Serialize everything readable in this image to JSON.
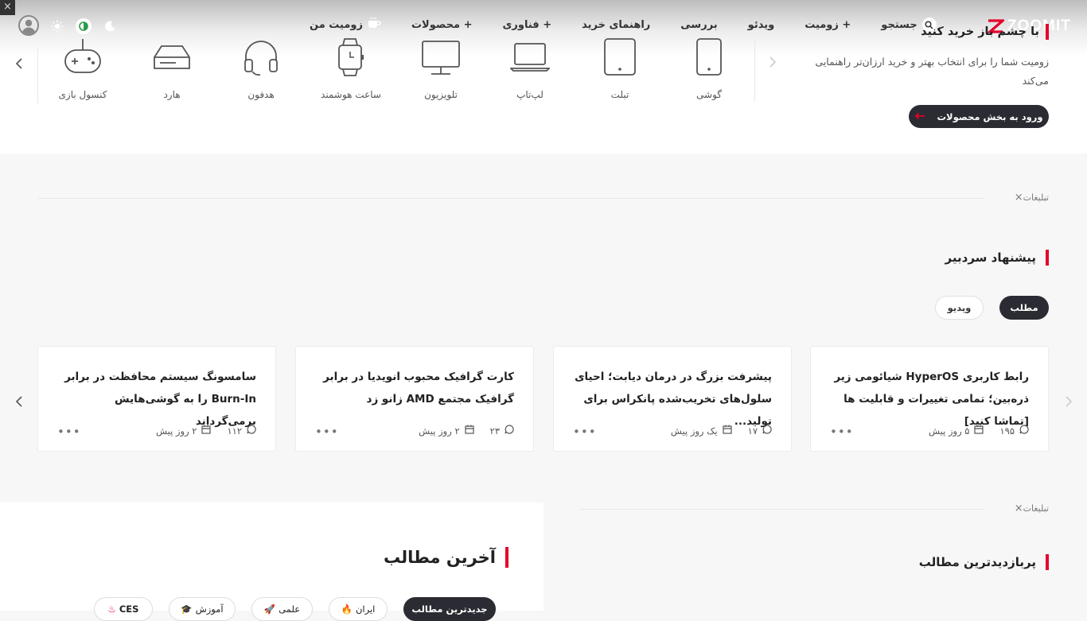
{
  "header": {
    "logo_text": "ZOOMIT",
    "nav": [
      {
        "label": "زومیت من",
        "icon": "coffee-cup-icon"
      },
      {
        "label": "+ محصولات"
      },
      {
        "label": "+ فناوری"
      },
      {
        "label": "راهنمای خرید"
      },
      {
        "label": "بررسی"
      },
      {
        "label": "ویدئو"
      },
      {
        "label": "+ زومیت"
      },
      {
        "label": "جستجو",
        "icon": "search-icon"
      }
    ],
    "close_glyph": "×",
    "theme_icons": [
      "moon-icon",
      "auto-theme-icon",
      "sun-icon"
    ]
  },
  "product_finder": {
    "title": "با چشم باز خرید کنید",
    "description": "زومیت شما را برای انتخاب بهتر و خرید ارزان‌تر راهنمایی می‌کند",
    "button_label": "ورود به بخش محصولات",
    "categories": [
      {
        "label": "گوشی",
        "icon": "phone-icon"
      },
      {
        "label": "تبلت",
        "icon": "tablet-icon"
      },
      {
        "label": "لپ‌تاپ",
        "icon": "laptop-icon"
      },
      {
        "label": "تلویزیون",
        "icon": "tv-icon"
      },
      {
        "label": "ساعت هوشمند",
        "icon": "smartwatch-icon"
      },
      {
        "label": "هدفون",
        "icon": "headphone-icon"
      },
      {
        "label": "هارد",
        "icon": "hard-drive-icon"
      },
      {
        "label": "کنسول بازی",
        "icon": "gamepad-icon"
      }
    ]
  },
  "ads": {
    "label": "تبلیغات"
  },
  "editor_pick": {
    "title": "پیشنهاد سردبیر",
    "tabs": [
      "مطلب",
      "ویدیو"
    ],
    "cards": [
      {
        "title": "رابط کاربری HyperOS شیائومی زیر ذره‌بین؛ تمامی تغییرات و قابلیت ها [تماشا کنید]",
        "comments": "۱۹۵",
        "date": "۵ روز پیش"
      },
      {
        "title": "پیشرفت بزرگ در درمان دیابت؛ احیای سلول‌های تخریب‌شده پانکراس برای تولید...",
        "comments": "۱۷",
        "date": "یک روز پیش"
      },
      {
        "title": "کارت گرافیک محبوب انویدیا در برابر گرافیک مجتمع AMD زانو زد",
        "comments": "۲۳",
        "date": "۲ روز پیش"
      },
      {
        "title": "سامسونگ سیستم محافظت در برابر Burn-In را به گوشی‌هایش برمی‌گرداند",
        "comments": "۱۱۲",
        "date": "۲ روز پیش"
      }
    ]
  },
  "most_viewed": {
    "title": "پربازدیدترین مطالب"
  },
  "latest": {
    "title": "آخرین مطالب",
    "pills": [
      {
        "label": "جدیدترین مطالب"
      },
      {
        "label": "ایران",
        "icon": "fire-icon"
      },
      {
        "label": "علمی",
        "icon": "rocket-icon"
      },
      {
        "label": "آموزش",
        "icon": "graduation-cap-icon"
      },
      {
        "label": "CES",
        "icon": "hot-icon"
      }
    ]
  },
  "colors": {
    "accent": "#e4002b",
    "dark": "#2b2b33"
  }
}
